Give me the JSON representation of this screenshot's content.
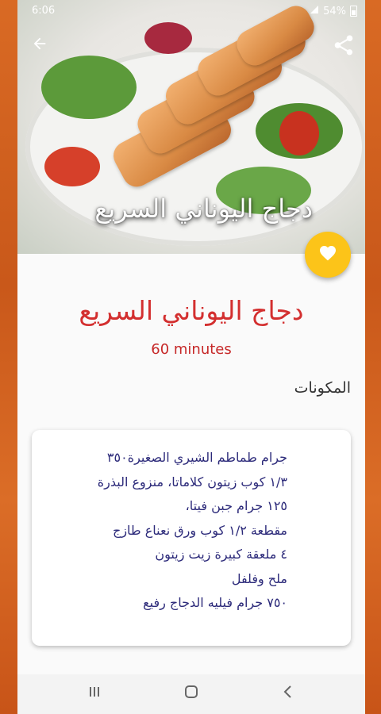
{
  "status_bar": {
    "time": "6:06",
    "battery": "54%"
  },
  "hero": {
    "title": "دجاج اليوناني السريع"
  },
  "recipe": {
    "title": "دجاج اليوناني السريع",
    "duration": "60 minutes",
    "ingredients_label": "المكونات",
    "ingredients": [
      "جرام طماطم الشيري الصغيرة٣٥٠",
      "١/٣ كوب زيتون كلاماتا، منزوع البذرة",
      "١٢٥ جرام جبن فيتا،",
      "مقطعة ١/٢ كوب ورق نعناع طازج",
      "٤ ملعقة كبيرة زيت زيتون",
      "ملح وفلفل",
      "٧٥٠ جرام فيليه الدجاج رفيع"
    ]
  },
  "icons": {
    "back": "back-arrow-icon",
    "share": "share-icon",
    "favorite": "heart-icon",
    "nav_recents": "recents-icon",
    "nav_home": "home-icon",
    "nav_back": "nav-back-icon"
  },
  "colors": {
    "accent_title": "#d32f2f",
    "fab": "#fcc419",
    "ingredient_text": "#2c2a7a",
    "frame": "#d4621c"
  }
}
